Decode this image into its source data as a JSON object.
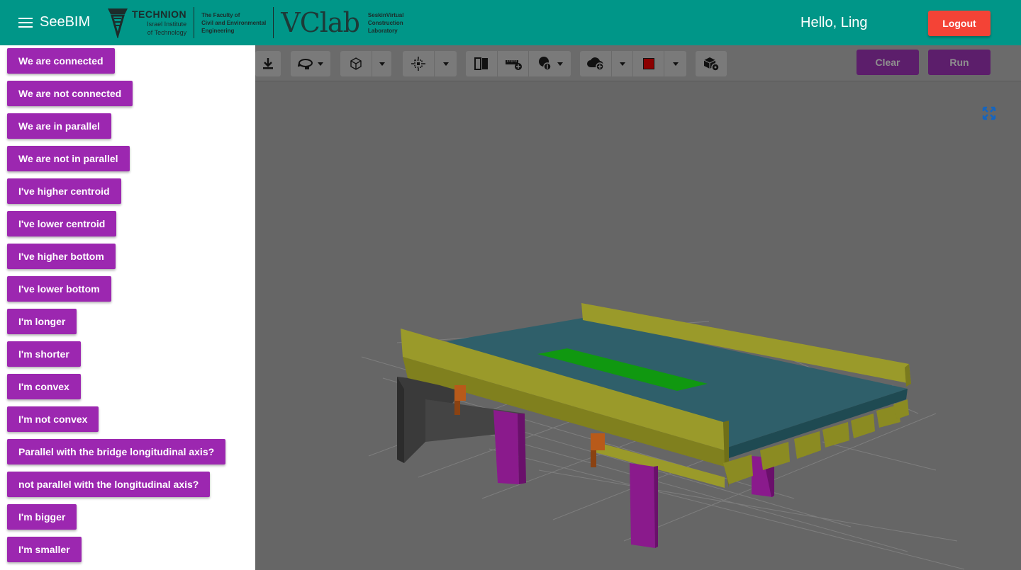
{
  "header": {
    "app_title": "SeeBIM",
    "logo_technion_name": "TECHNION",
    "logo_technion_sub1": "Israel Institute",
    "logo_technion_sub2": "of Technology",
    "logo_faculty_line1": "The Faculty of",
    "logo_faculty_line2": "Civil and Environmental",
    "logo_faculty_line3": "Engineering",
    "logo_vclab": "VClab",
    "logo_seskin_line1": "SeskinVirtual",
    "logo_seskin_line2": "Construction",
    "logo_seskin_line3": "Laboratory",
    "greeting": "Hello, Ling",
    "logout_label": "Logout",
    "brand_color": "#009688",
    "logout_color": "#f44336"
  },
  "sidebar": {
    "button_color": "#9c27b0",
    "items": [
      {
        "label": "We are connected"
      },
      {
        "label": "We are not connected"
      },
      {
        "label": "We are in parallel"
      },
      {
        "label": "We are not in parallel"
      },
      {
        "label": "I've higher centroid"
      },
      {
        "label": "I've lower centroid"
      },
      {
        "label": "I've higher bottom"
      },
      {
        "label": "I've lower bottom"
      },
      {
        "label": "I'm longer"
      },
      {
        "label": "I'm shorter"
      },
      {
        "label": "I'm convex"
      },
      {
        "label": "I'm not convex"
      },
      {
        "label": "Parallel with the bridge longitudinal axis?"
      },
      {
        "label": "not parallel with the longitudinal axis?"
      },
      {
        "label": "I'm bigger"
      },
      {
        "label": "I'm smaller"
      }
    ]
  },
  "toolbar": {
    "tools": [
      "download-icon",
      "orbit-icon",
      "cube-view-icon",
      "focus-icon",
      "section-icon",
      "measure-icon",
      "explode-icon",
      "cloud-add-icon",
      "color-swatch-icon",
      "model-settings-icon"
    ],
    "swatch_color": "#8b0000",
    "clear_label": "Clear",
    "run_label": "Run"
  },
  "viewer": {
    "fullscreen_icon": "fullscreen-icon",
    "scene_colors": {
      "deck": "#2f5f6a",
      "girder": "#9a9a2a",
      "highlight": "#109810",
      "pier": "#8a1a8c",
      "bearing": "#b85a1a",
      "abutment": "#3a3a3a"
    }
  }
}
